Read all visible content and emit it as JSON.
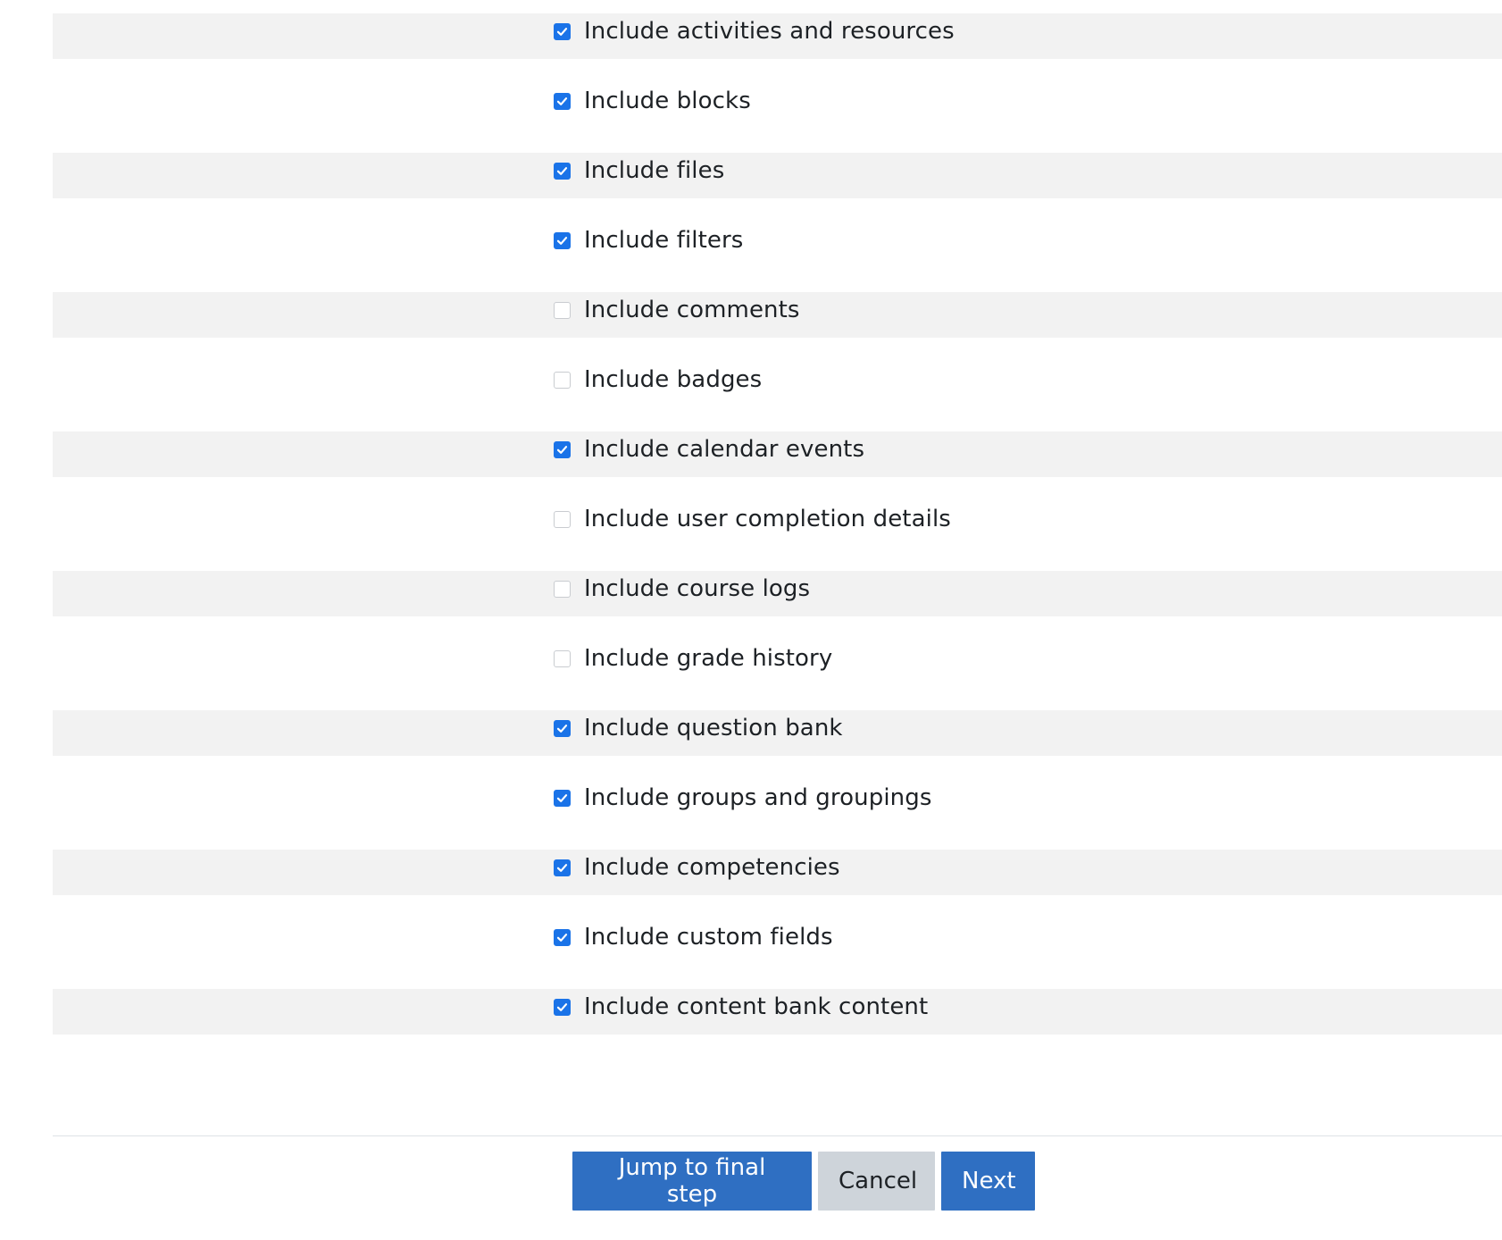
{
  "settings": [
    {
      "label": "Include activities and resources",
      "checked": true
    },
    {
      "label": "Include blocks",
      "checked": true
    },
    {
      "label": "Include files",
      "checked": true
    },
    {
      "label": "Include filters",
      "checked": true
    },
    {
      "label": "Include comments",
      "checked": false
    },
    {
      "label": "Include badges",
      "checked": false
    },
    {
      "label": "Include calendar events",
      "checked": true
    },
    {
      "label": "Include user completion details",
      "checked": false
    },
    {
      "label": "Include course logs",
      "checked": false
    },
    {
      "label": "Include grade history",
      "checked": false
    },
    {
      "label": "Include question bank",
      "checked": true
    },
    {
      "label": "Include groups and groupings",
      "checked": true
    },
    {
      "label": "Include competencies",
      "checked": true
    },
    {
      "label": "Include custom fields",
      "checked": true
    },
    {
      "label": "Include content bank content",
      "checked": true
    }
  ],
  "buttons": {
    "jump_label": "Jump to final step",
    "cancel_label": "Cancel",
    "next_label": "Next"
  },
  "colors": {
    "checkbox_checked": "#1a73e8",
    "primary_button": "#2f6fc2",
    "secondary_button": "#ced4da",
    "stripe": "#f2f2f2"
  }
}
